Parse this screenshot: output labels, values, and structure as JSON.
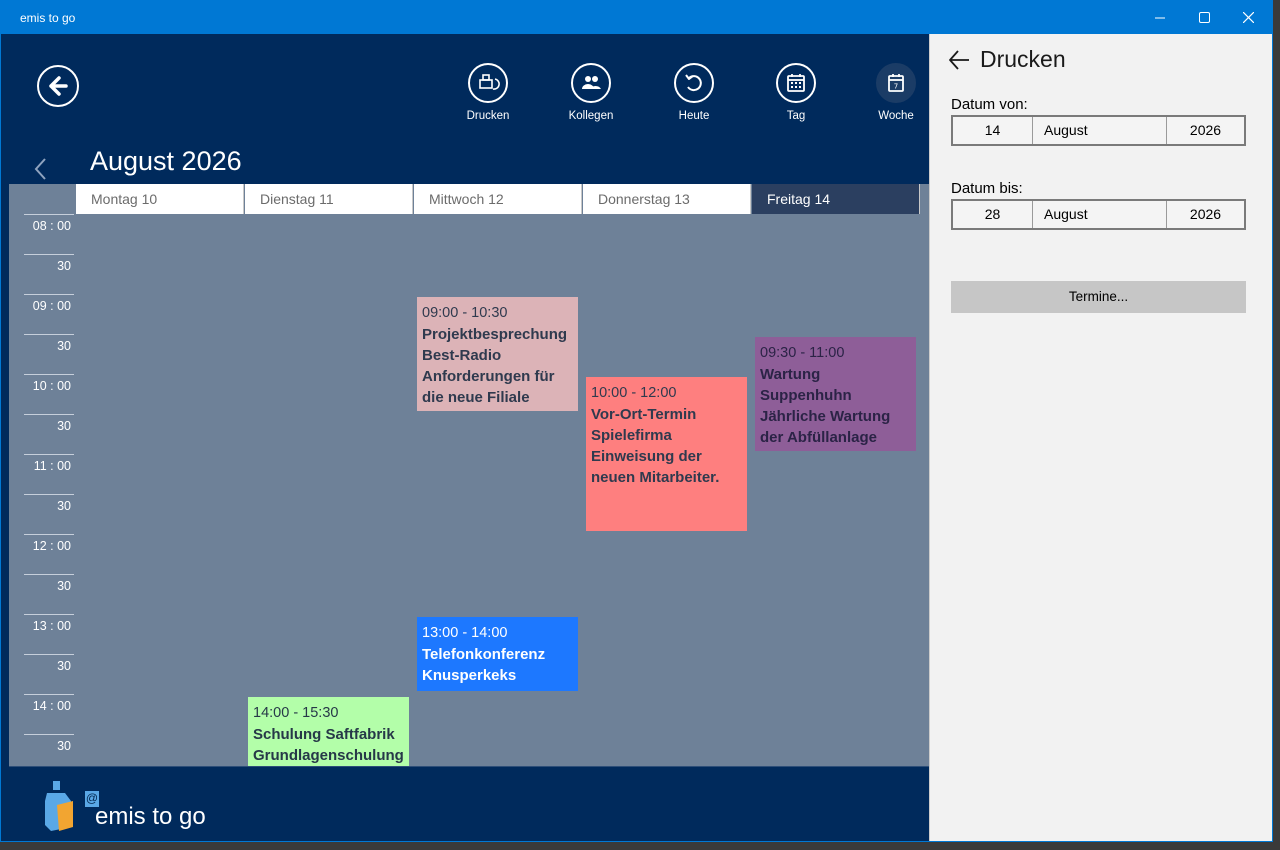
{
  "window": {
    "title": "emis to go"
  },
  "toolbar": {
    "buttons": [
      {
        "label": "Drucken"
      },
      {
        "label": "Kollegen"
      },
      {
        "label": "Heute"
      },
      {
        "label": "Tag"
      },
      {
        "label": "Woche"
      }
    ]
  },
  "calendar": {
    "month_title": "August 2026",
    "days": [
      "Montag 10",
      "Dienstag 11",
      "Mittwoch 12",
      "Donnerstag 13",
      "Freitag 14"
    ],
    "selected_day": "Freitag 14",
    "time_labels": [
      "08 : 00",
      "30",
      "09 : 00",
      "30",
      "10 : 00",
      "30",
      "11 : 00",
      "30",
      "12 : 00",
      "30",
      "13 : 00",
      "30",
      "14 : 00",
      "30"
    ],
    "events": [
      {
        "time": "09:00 - 10:30",
        "title_lines": [
          "Projektbesprechung",
          "Best-Radio",
          "Anforderungen für",
          "die neue Filiale"
        ],
        "color": "#dcb3b7",
        "text_color": "#2f3a4e"
      },
      {
        "time": "10:00 - 12:00",
        "title_lines": [
          "Vor-Ort-Termin",
          "Spielefirma",
          "Einweisung der",
          "neuen Mitarbeiter."
        ],
        "color": "#fe7f7f",
        "text_color": "#2f3a4e"
      },
      {
        "time": "09:30 - 11:00",
        "title_lines": [
          "Wartung",
          "Suppenhuhn",
          "Jährliche Wartung",
          "der Abfüllanlage"
        ],
        "color": "#8e5e98",
        "text_color": "#2b2346"
      },
      {
        "time": "13:00 - 14:00",
        "title_lines": [
          "Telefonkonferenz",
          "Knusperkeks"
        ],
        "color": "#1d78ff",
        "text_color": "#ffffff"
      },
      {
        "time": "14:00 - 15:30",
        "title_lines": [
          "Schulung Saftfabrik",
          "Grundlagenschulung"
        ],
        "color": "#b3fea9",
        "text_color": "#263848"
      }
    ]
  },
  "footer": {
    "brand": "emis to go",
    "at_symbol": "@"
  },
  "print_panel": {
    "title": "Drucken",
    "from_label": "Datum von:",
    "from": {
      "day": "14",
      "month": "August",
      "year": "2026"
    },
    "to_label": "Datum bis:",
    "to": {
      "day": "28",
      "month": "August",
      "year": "2026"
    },
    "button_label": "Termine..."
  },
  "colors": {
    "titlebar": "#0078d4",
    "app_bg": "#002a5c",
    "grid_bg": "#6e8198",
    "panel_bg": "#f2f2f2"
  }
}
